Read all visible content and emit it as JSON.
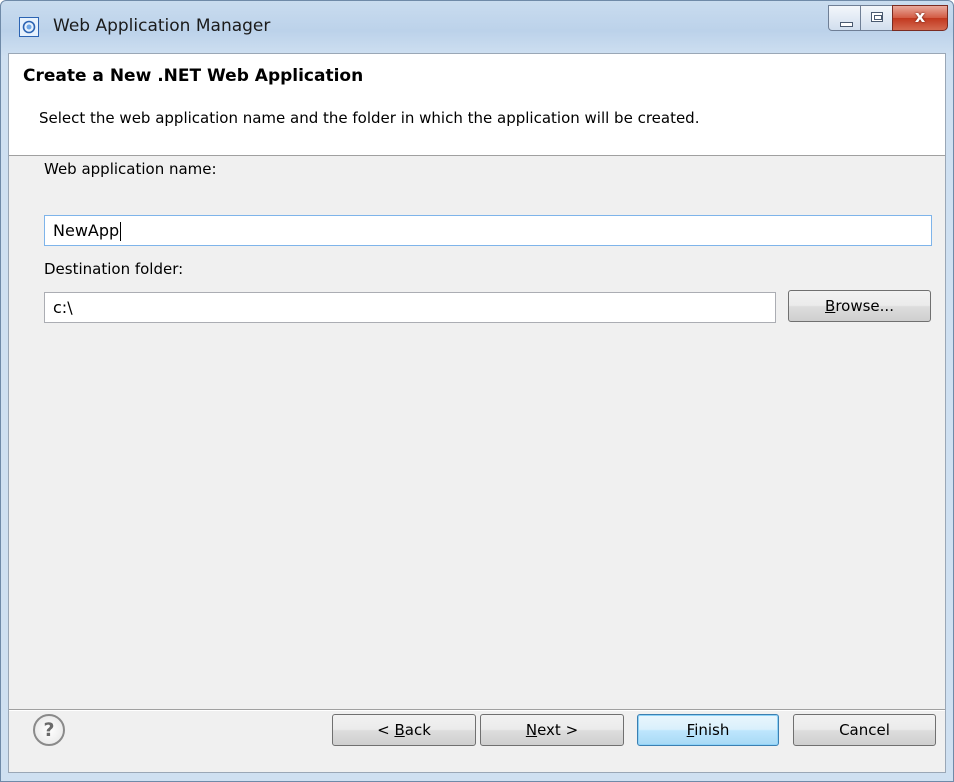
{
  "window": {
    "title": "Web Application Manager",
    "close_glyph": "x"
  },
  "banner": {
    "title": "Create a New .NET Web Application",
    "description": "Select the web application name and the folder in which the application will be created."
  },
  "form": {
    "name_label": "Web application name:",
    "name_value": "NewApp",
    "folder_label": "Destination folder:",
    "folder_value": "c:\\",
    "browse_label": {
      "mnemonic": "B",
      "rest": "rowse..."
    }
  },
  "footer": {
    "help_glyph": "?",
    "back_label": {
      "prefix": "< ",
      "mnemonic": "B",
      "rest": "ack"
    },
    "next_label": {
      "mnemonic": "N",
      "rest": "ext >"
    },
    "finish_label": {
      "mnemonic": "F",
      "rest": "inish"
    },
    "cancel_label": "Cancel"
  }
}
